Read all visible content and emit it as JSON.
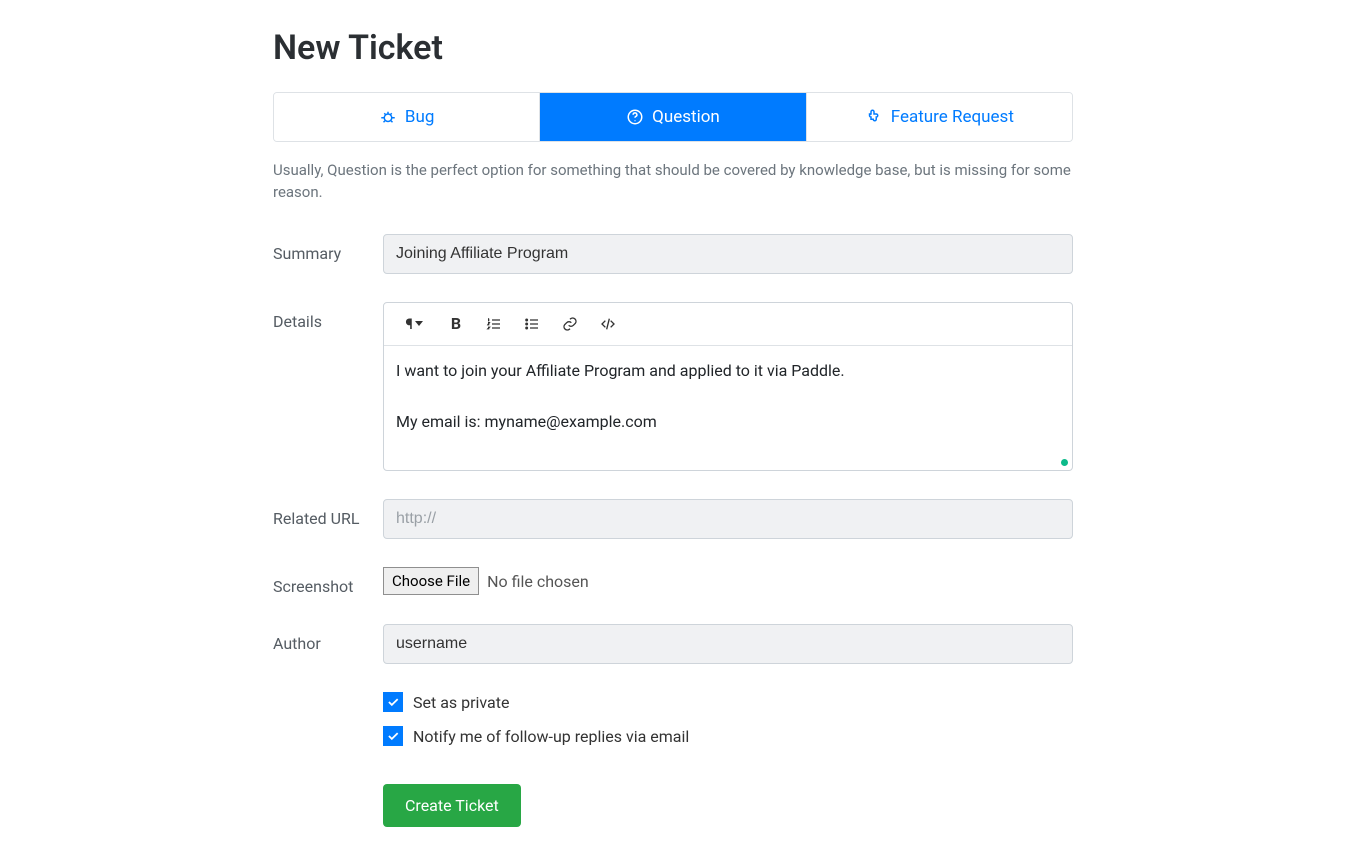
{
  "page_title": "New Ticket",
  "tabs": {
    "bug": "Bug",
    "question": "Question",
    "feature": "Feature Request"
  },
  "helptext": "Usually, Question is the perfect option for something that should be covered by knowledge base, but is missing for some reason.",
  "labels": {
    "summary": "Summary",
    "details": "Details",
    "related_url": "Related URL",
    "screenshot": "Screenshot",
    "author": "Author"
  },
  "summary_value": "Joining Affiliate Program",
  "details_line1": "I want to join your Affiliate Program and applied to it via Paddle.",
  "details_line2": "My email is: myname@example.com",
  "related_url_placeholder": "http://",
  "file": {
    "button": "Choose File",
    "status": "No file chosen"
  },
  "author_value": "username",
  "checkboxes": {
    "private": "Set as private",
    "notify": "Notify me of follow-up replies via email"
  },
  "submit_label": "Create Ticket"
}
